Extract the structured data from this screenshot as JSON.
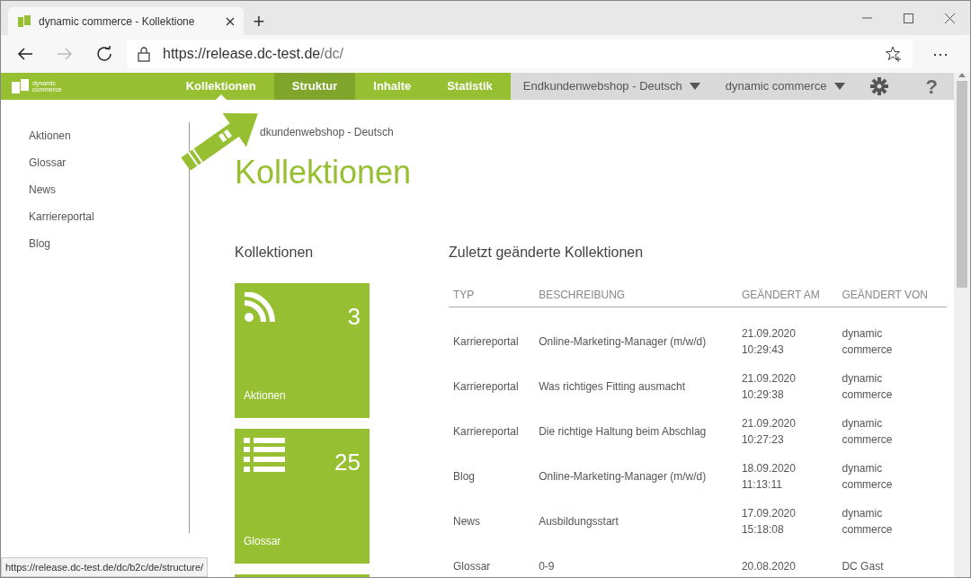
{
  "browser": {
    "tab_title": "dynamic commerce - Kollektione",
    "new_tab": "+",
    "url_host": "https://release.dc-test.de",
    "url_path": "/dc/",
    "more": "···",
    "status_url": "https://release.dc-test.de/dc/b2c/de/structure/"
  },
  "app_nav": {
    "logo": [
      "dynamic",
      "commerce"
    ],
    "items": [
      {
        "label": "Kollektionen",
        "selected": true,
        "highlighted": false
      },
      {
        "label": "Struktur",
        "selected": false,
        "highlighted": true
      },
      {
        "label": "Inhalte",
        "selected": false,
        "highlighted": false
      },
      {
        "label": "Statistik",
        "selected": false,
        "highlighted": false
      }
    ],
    "dropdowns": [
      "Endkundenwebshop - Deutsch",
      "dynamic commerce"
    ],
    "help": "?"
  },
  "sidebar": {
    "items": [
      "Aktionen",
      "Glossar",
      "News",
      "Karriereportal",
      "Blog"
    ]
  },
  "breadcrumb": "dkundenwebshop - Deutsch",
  "title": "Kollektionen",
  "collections": {
    "heading": "Kollektionen",
    "tiles": [
      {
        "kind": "feed",
        "count": "3",
        "label": "Aktionen"
      },
      {
        "kind": "list",
        "count": "25",
        "label": "Glossar"
      },
      {
        "kind": "partial"
      }
    ]
  },
  "recent": {
    "heading": "Zuletzt geänderte Kollektionen",
    "columns": [
      "TYP",
      "BESCHREIBUNG",
      "GEÄNDERT AM",
      "GEÄNDERT VON"
    ],
    "rows": [
      [
        "Karriereportal",
        "Online-Marketing-Manager (m/w/d)",
        "21.09.2020\n10:29:43",
        "dynamic\ncommerce"
      ],
      [
        "Karriereportal",
        "Was richtiges Fitting ausmacht",
        "21.09.2020\n10:29:38",
        "dynamic\ncommerce"
      ],
      [
        "Karriereportal",
        "Die richtige Haltung beim Abschlag",
        "21.09.2020\n10:27:23",
        "dynamic\ncommerce"
      ],
      [
        "Blog",
        "Online-Marketing-Manager (m/w/d)",
        "18.09.2020\n11:13:11",
        "dynamic\ncommerce"
      ],
      [
        "News",
        "Ausbildungsstart",
        "17.09.2020\n15:18:08",
        "dynamic\ncommerce"
      ],
      [
        "Glossar",
        "0-9",
        "20.08.2020",
        "DC Gast"
      ]
    ]
  }
}
